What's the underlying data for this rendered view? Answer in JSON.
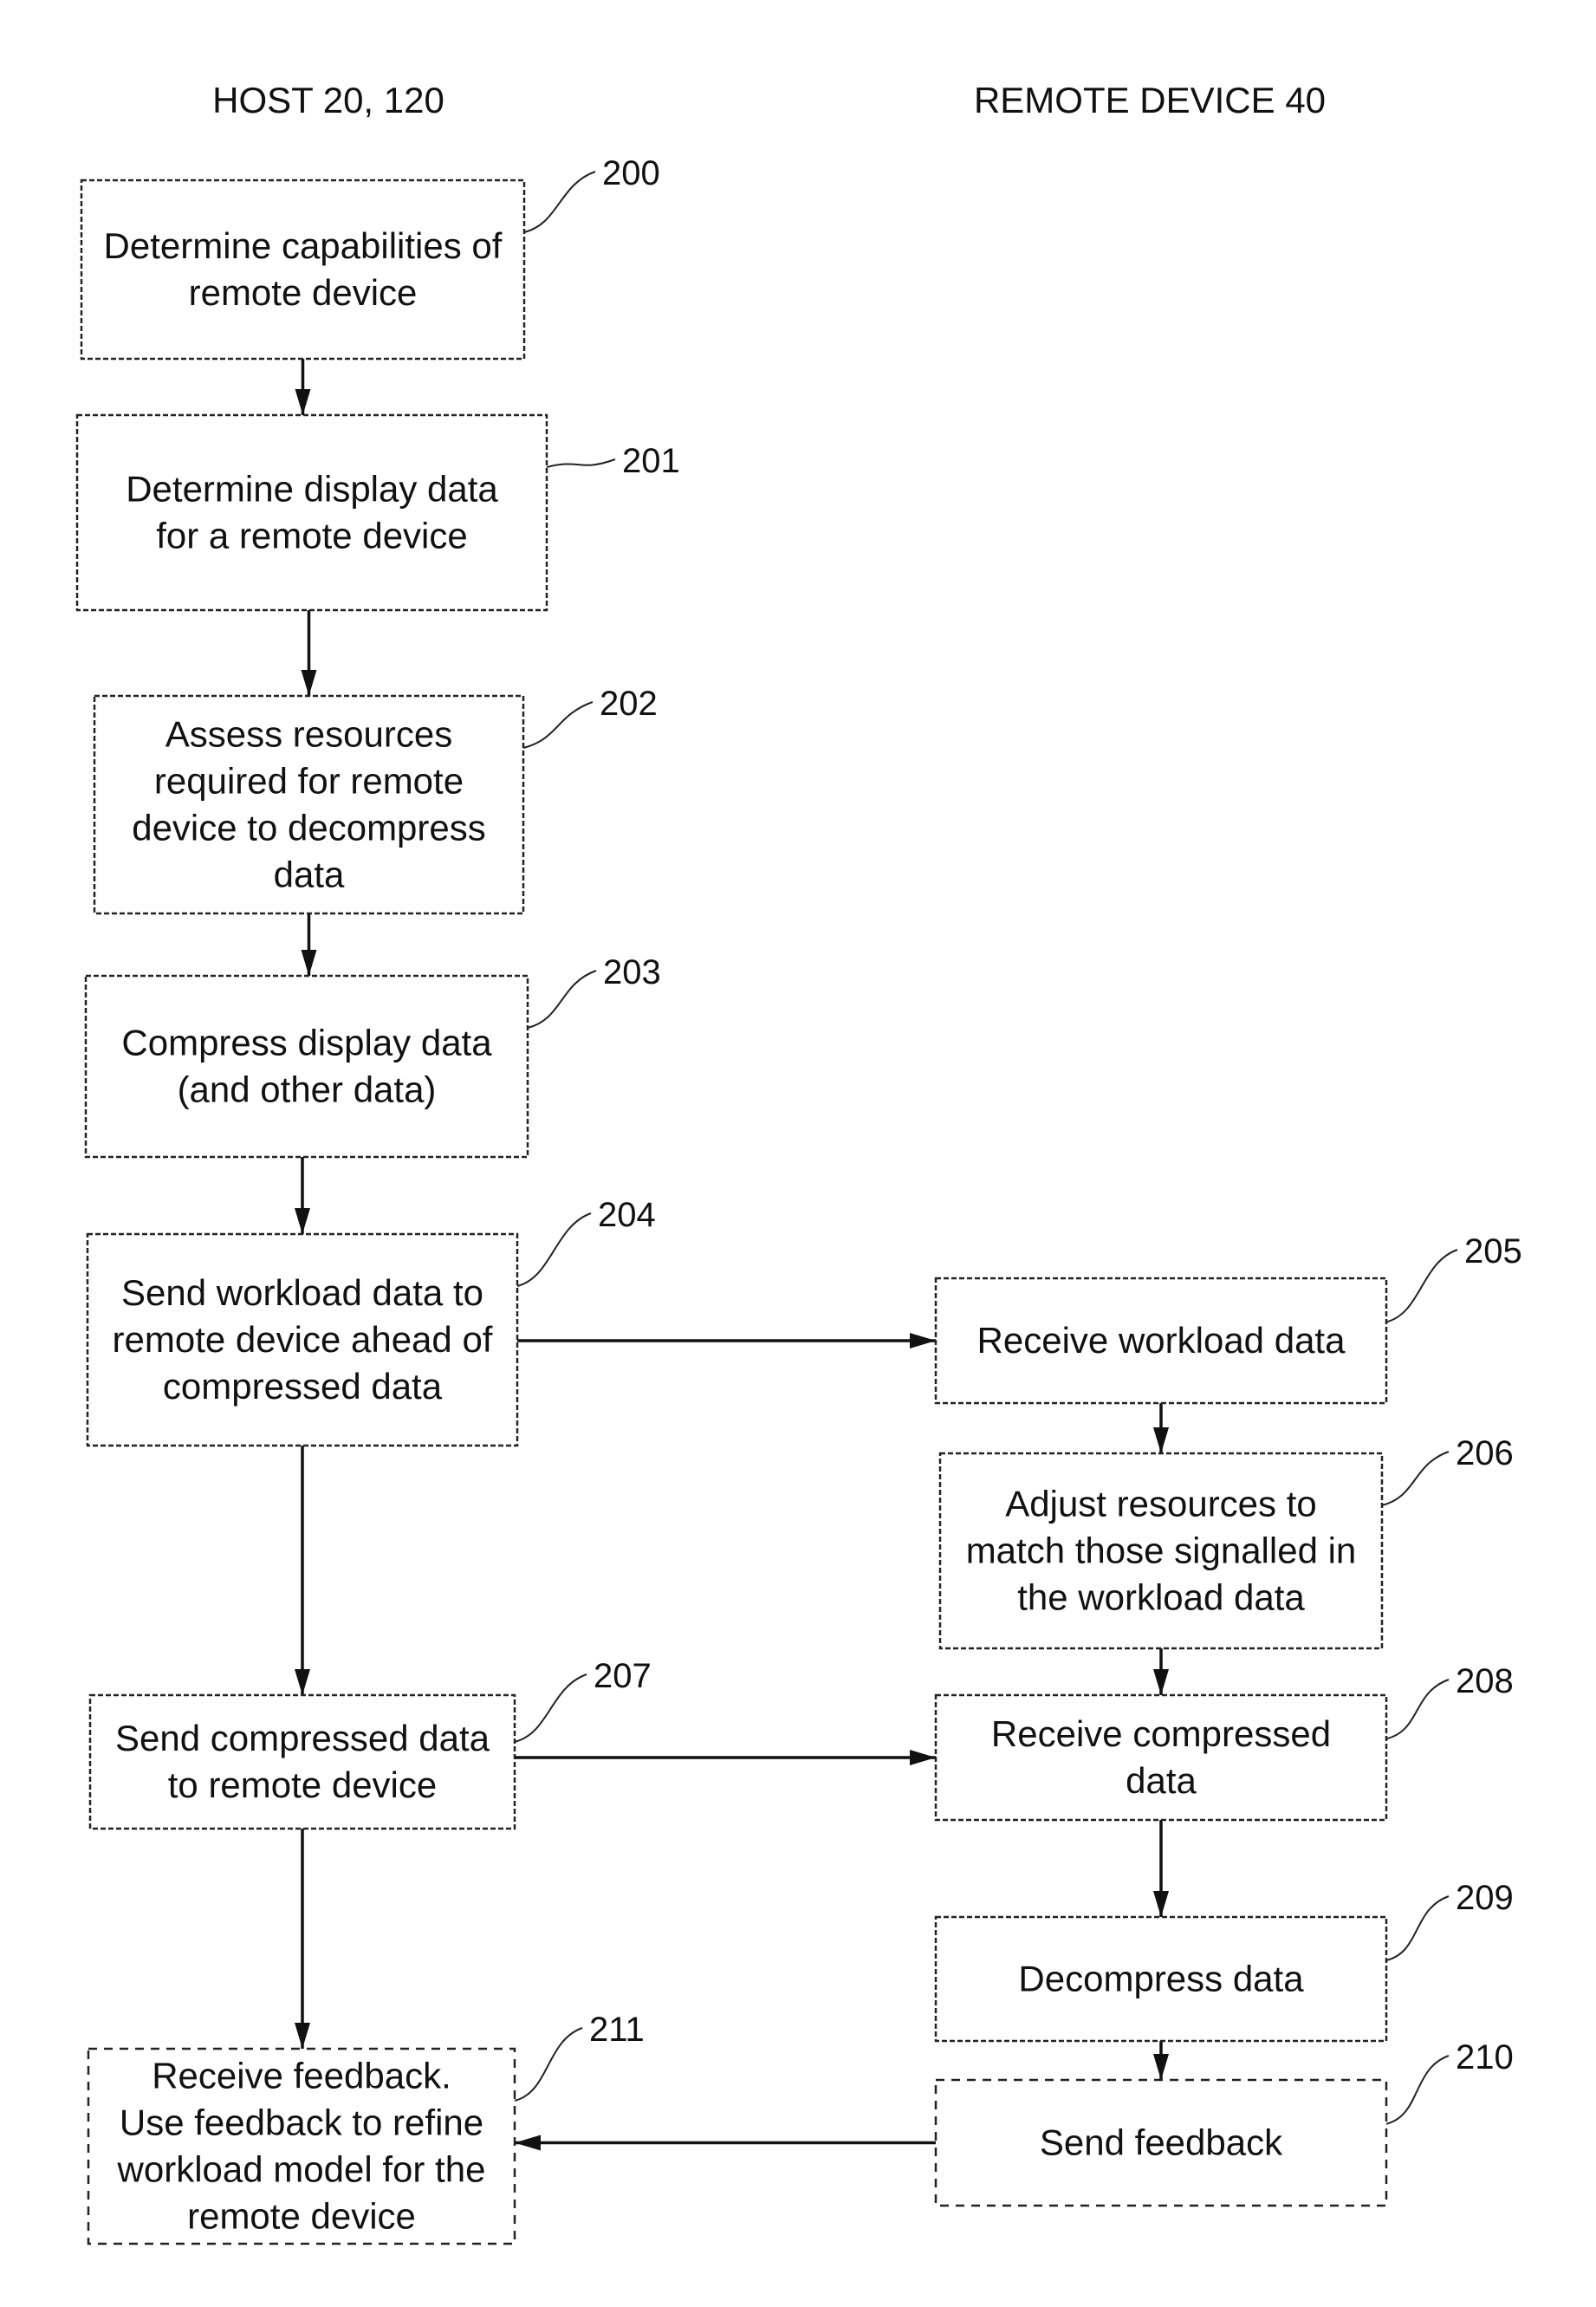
{
  "headers": {
    "host": "HOST  20, 120",
    "remote": "REMOTE DEVICE  40"
  },
  "steps": [
    {
      "id": "200",
      "ref": "200",
      "lines": [
        "Determine capabilities of",
        "remote device"
      ],
      "column": "host"
    },
    {
      "id": "201",
      "ref": "201",
      "lines": [
        "Determine display data",
        "for a remote device"
      ],
      "column": "host"
    },
    {
      "id": "202",
      "ref": "202",
      "lines": [
        "Assess resources",
        "required for remote",
        "device to decompress",
        "data"
      ],
      "column": "host"
    },
    {
      "id": "203",
      "ref": "203",
      "lines": [
        "Compress display data",
        "(and other data)"
      ],
      "column": "host"
    },
    {
      "id": "204",
      "ref": "204",
      "lines": [
        "Send workload data to",
        "remote device ahead of",
        "compressed data"
      ],
      "column": "host"
    },
    {
      "id": "205",
      "ref": "205",
      "lines": [
        "Receive workload data"
      ],
      "column": "remote"
    },
    {
      "id": "206",
      "ref": "206",
      "lines": [
        "Adjust resources to",
        "match those signalled in",
        "the workload data"
      ],
      "column": "remote"
    },
    {
      "id": "207",
      "ref": "207",
      "lines": [
        "Send compressed data",
        "to remote device"
      ],
      "column": "host"
    },
    {
      "id": "208",
      "ref": "208",
      "lines": [
        "Receive compressed",
        "data"
      ],
      "column": "remote"
    },
    {
      "id": "209",
      "ref": "209",
      "lines": [
        "Decompress data"
      ],
      "column": "remote"
    },
    {
      "id": "210",
      "ref": "210",
      "lines": [
        "Send feedback"
      ],
      "column": "remote",
      "optional": true
    },
    {
      "id": "211",
      "ref": "211",
      "lines": [
        "Receive feedback.",
        "Use feedback to refine",
        "workload model for the",
        "remote device"
      ],
      "column": "host",
      "optional": true
    }
  ],
  "edges": [
    {
      "from": "200",
      "to": "201"
    },
    {
      "from": "201",
      "to": "202"
    },
    {
      "from": "202",
      "to": "203"
    },
    {
      "from": "203",
      "to": "204"
    },
    {
      "from": "204",
      "to": "205"
    },
    {
      "from": "205",
      "to": "206"
    },
    {
      "from": "204",
      "to": "207"
    },
    {
      "from": "206",
      "to": "208"
    },
    {
      "from": "207",
      "to": "208"
    },
    {
      "from": "208",
      "to": "209"
    },
    {
      "from": "209",
      "to": "210"
    },
    {
      "from": "207",
      "to": "211"
    },
    {
      "from": "210",
      "to": "211"
    }
  ]
}
